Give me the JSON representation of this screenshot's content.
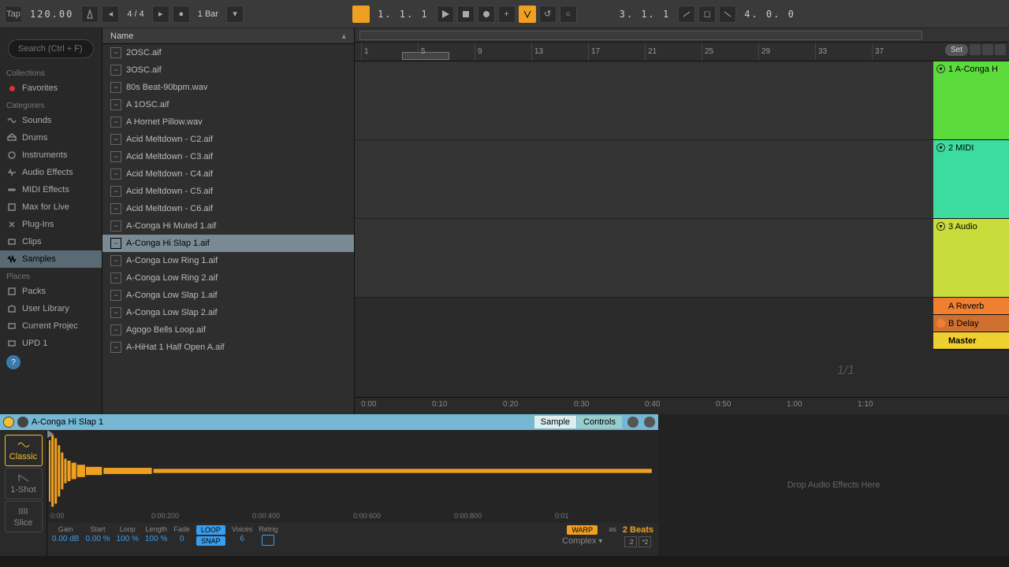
{
  "transport": {
    "tap": "Tap",
    "tempo": "120.00",
    "sig": "4 / 4",
    "bars": "1 Bar",
    "pos": "1. 1. 1",
    "pos2": "3. 1. 1",
    "pos3": "4. 0. 0"
  },
  "search": {
    "placeholder": "Search (Ctrl + F)"
  },
  "sidebar": {
    "collections": "Collections",
    "favorites": "Favorites",
    "categories": "Categories",
    "items": [
      "Sounds",
      "Drums",
      "Instruments",
      "Audio Effects",
      "MIDI Effects",
      "Max for Live",
      "Plug-Ins",
      "Clips",
      "Samples"
    ],
    "places": "Places",
    "place_items": [
      "Packs",
      "User Library",
      "Current Projec",
      "UPD 1"
    ]
  },
  "browser": {
    "header": "Name",
    "files": [
      "2OSC.aif",
      "3OSC.aif",
      "80s Beat-90bpm.wav",
      "A 1OSC.aif",
      "A Hornet Pillow.wav",
      "Acid Meltdown - C2.aif",
      "Acid Meltdown - C3.aif",
      "Acid Meltdown - C4.aif",
      "Acid Meltdown - C5.aif",
      "Acid Meltdown - C6.aif",
      "A-Conga Hi Muted 1.aif",
      "A-Conga Hi Slap 1.aif",
      "A-Conga Low Ring 1.aif",
      "A-Conga Low Ring 2.aif",
      "A-Conga Low Slap 1.aif",
      "A-Conga Low Slap 2.aif",
      "Agogo Bells Loop.aif",
      "A-HiHat 1 Half Open A.aif"
    ],
    "selected": 11
  },
  "arrange": {
    "beat_ticks": [
      "1",
      "5",
      "9",
      "13",
      "17",
      "21",
      "25",
      "29",
      "33",
      "37"
    ],
    "set": "Set",
    "tracks": [
      {
        "name": "1 A-Conga H",
        "color": "#5cdc3c"
      },
      {
        "name": "2 MIDI",
        "color": "#3cdca0"
      },
      {
        "name": "3 Audio",
        "color": "#c8dc3c"
      }
    ],
    "returns": [
      {
        "name": "A Reverb"
      },
      {
        "name": "B Delay"
      }
    ],
    "master": "Master",
    "time_ticks": [
      "0:00",
      "0:10",
      "0:20",
      "0:30",
      "0:40",
      "0:50",
      "1:00",
      "1:10"
    ],
    "frac": "1/1"
  },
  "clip": {
    "name": "A-Conga Hi Slap 1",
    "tabs": {
      "sample": "Sample",
      "controls": "Controls"
    },
    "modes": {
      "classic": "Classic",
      "oneshot": "1-Shot",
      "slice": "Slice"
    },
    "wave_ticks": [
      "0:00",
      "0:00:200",
      "0:00:400",
      "0:00:600",
      "0:00:800",
      "0:01"
    ],
    "params": {
      "gain_l": "Gain",
      "gain_v": "0.00 dB",
      "start_l": "Start",
      "start_v": "0.00 %",
      "loop_l": "Loop",
      "loop_v": "100 %",
      "length_l": "Length",
      "length_v": "100 %",
      "fade_l": "Fade",
      "fade_v": "0",
      "loopbtn": "LOOP",
      "snap": "SNAP",
      "voices_l": "Voices",
      "voices_v": "6",
      "retrig_l": "Retrig",
      "warp": "WARP",
      "as": "as",
      "beats": "2 Beats",
      "complex": "Complex",
      "halve": ":2",
      "double": "*2"
    }
  },
  "drop": "Drop Audio Effects Here"
}
